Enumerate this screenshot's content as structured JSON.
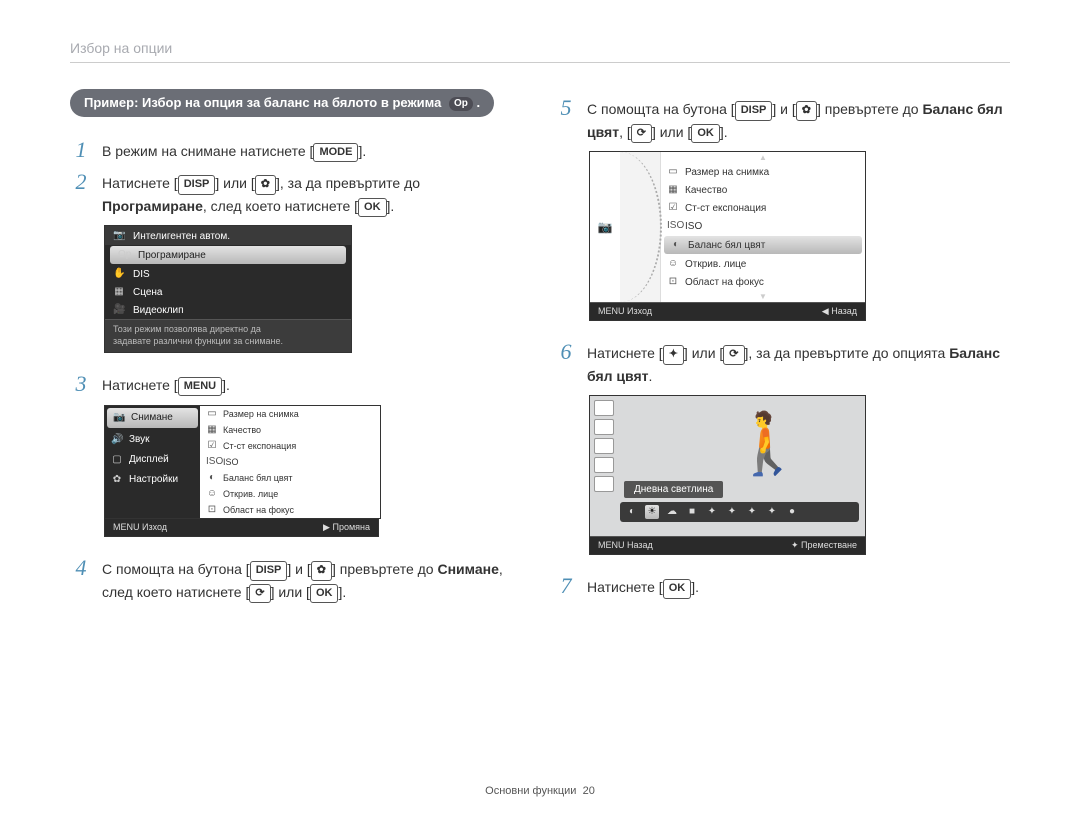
{
  "crumb": "Избор на опции",
  "pill_text": "Пример: Избор на опция за баланс на бялото в режима",
  "pill_mode_icon": "Op",
  "steps": {
    "s1": {
      "n": "1",
      "a": "В режим на снимане натиснете [",
      "b": "MODE",
      "c": "]."
    },
    "s2": {
      "n": "2",
      "a": "Натиснете [",
      "b": "DISP",
      "c": "] или [",
      "d": "✿",
      "e": "], за да превъртите до ",
      "f": "Програмиране",
      "g": ", след което натиснете [",
      "h": "OK",
      "i": "]."
    },
    "s3": {
      "n": "3",
      "a": "Натиснете [",
      "b": "MENU",
      "c": "]."
    },
    "s4": {
      "n": "4",
      "a": "С помощта на бутона [",
      "b": "DISP",
      "c": "] и [",
      "d": "✿",
      "e": "] превъртете до ",
      "f": "Снимане",
      "g": ", след което натиснете [",
      "h": "⟳",
      "i": "] или [",
      "j": "OK",
      "k": "]."
    },
    "s5": {
      "n": "5",
      "a": "С помощта на бутона [",
      "b": "DISP",
      "c": "] и [",
      "d": "✿",
      "e": "] превъртете до ",
      "f": "Баланс бял цвят",
      "g": ", [",
      "h": "⟳",
      "i": "] или [",
      "j": "OK",
      "k": "]."
    },
    "s6": {
      "n": "6",
      "a": "Натиснете [",
      "b": "✦",
      "c": "] или [",
      "d": "⟳",
      "e": "], за да превъртите до опцията ",
      "f": "Баланс бял цвят",
      "g": "."
    },
    "s7": {
      "n": "7",
      "a": "Натиснете [",
      "b": "OK",
      "c": "]."
    }
  },
  "sc1": {
    "items": [
      {
        "icon": "📷",
        "label": "Интелигентен автом."
      },
      {
        "icon": "Op",
        "label": "Програмиране",
        "sel": true
      },
      {
        "icon": "✋",
        "label": "DIS"
      },
      {
        "icon": "▦",
        "label": "Сцена"
      },
      {
        "icon": "🎥",
        "label": "Видеоклип"
      }
    ],
    "tip1": "Този режим позволява директно да",
    "tip2": "задавате различни функции за снимане."
  },
  "sc2": {
    "left": [
      {
        "icon": "📷",
        "label": "Снимане",
        "sel": true
      },
      {
        "icon": "🔊",
        "label": "Звук"
      },
      {
        "icon": "▢",
        "label": "Дисплей"
      },
      {
        "icon": "✿",
        "label": "Настройки"
      }
    ],
    "right": [
      {
        "icon": "▭",
        "label": "Размер на снимка"
      },
      {
        "icon": "▦",
        "label": "Качество"
      },
      {
        "icon": "☑",
        "label": "Ст-ст експонация"
      },
      {
        "icon": "ISO",
        "label": "ISO"
      },
      {
        "icon": "◐",
        "label": "Баланс бял цвят"
      },
      {
        "icon": "☺",
        "label": "Открив. лице"
      },
      {
        "icon": "⊡",
        "label": "Област на фокус"
      }
    ],
    "foot_l": "MENU Изход",
    "foot_r": "▶ Промяна"
  },
  "sc3": {
    "cam": "📷",
    "list": [
      {
        "icon": "▭",
        "label": "Размер на снимка"
      },
      {
        "icon": "▦",
        "label": "Качество"
      },
      {
        "icon": "☑",
        "label": "Ст-ст експонация"
      },
      {
        "icon": "ISO",
        "label": "ISO"
      },
      {
        "icon": "◐",
        "label": "Баланс бял цвят",
        "sel": true
      },
      {
        "icon": "☺",
        "label": "Открив. лице"
      },
      {
        "icon": "⊡",
        "label": "Област на фокус"
      }
    ],
    "foot_l": "MENU Изход",
    "foot_r": "◀ Назад"
  },
  "sc4": {
    "leftbar": [
      "▭",
      "▦",
      "☑",
      "ISO",
      "◐"
    ],
    "label": "Дневна светлина",
    "strip": [
      "◐",
      "☀",
      "☁",
      "■",
      "✦",
      "✦",
      "✦",
      "✦",
      "●"
    ],
    "strip_sel": 1,
    "foot_l": "MENU Назад",
    "foot_r": "✦ Преместване"
  },
  "footer": {
    "a": "Основни функции",
    "b": "20"
  }
}
